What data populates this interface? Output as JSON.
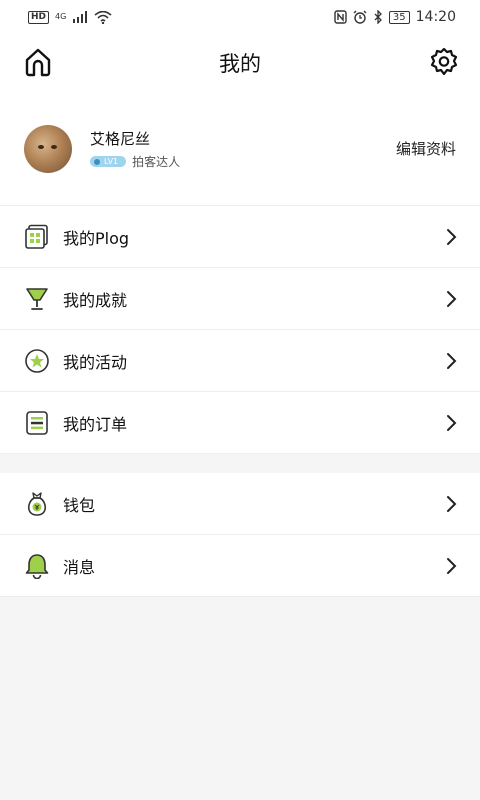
{
  "status_bar": {
    "hd": "HD",
    "network": "4G",
    "battery": "35",
    "time": "14:20"
  },
  "header": {
    "title": "我的"
  },
  "profile": {
    "name": "艾格尼丝",
    "level": "LV1",
    "tag": "拍客达人",
    "edit_label": "编辑资料"
  },
  "menu_primary": [
    {
      "label": "我的Plog",
      "icon": "plog-icon"
    },
    {
      "label": "我的成就",
      "icon": "trophy-icon"
    },
    {
      "label": "我的活动",
      "icon": "star-badge-icon"
    },
    {
      "label": "我的订单",
      "icon": "order-list-icon"
    }
  ],
  "menu_secondary": [
    {
      "label": "钱包",
      "icon": "money-bag-icon"
    },
    {
      "label": "消息",
      "icon": "bell-icon"
    }
  ],
  "colors": {
    "accent_green": "#9ed04a",
    "icon_dark": "#333333"
  }
}
